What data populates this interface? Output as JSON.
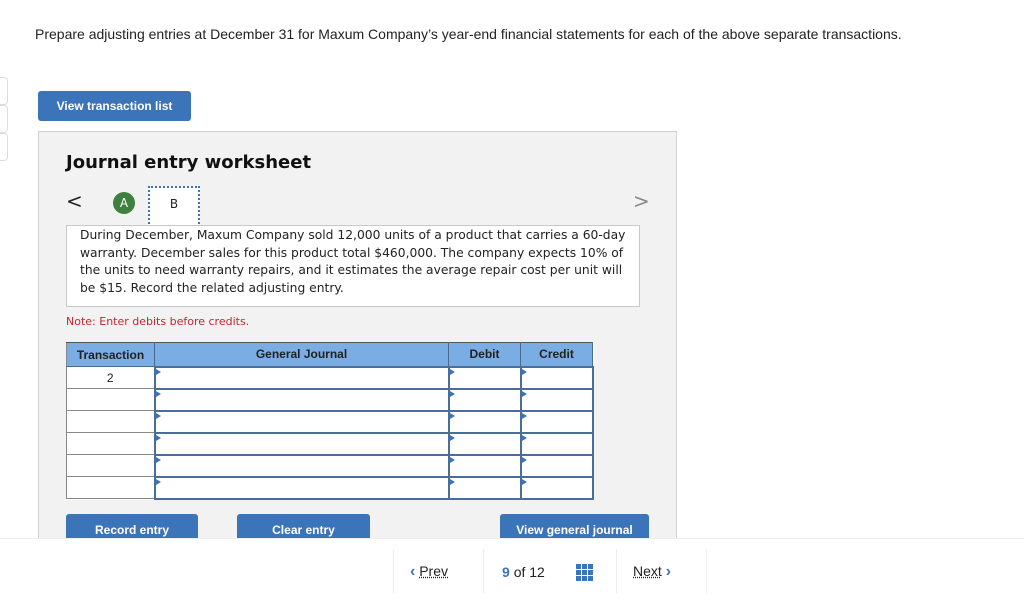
{
  "instructions": "Prepare adjusting entries at December 31 for Maxum Company’s year-end financial statements for each of the above separate transactions.",
  "buttons": {
    "view_transaction_list": "View transaction list",
    "record_entry": "Record entry",
    "clear_entry": "Clear entry",
    "view_general_journal": "View general journal"
  },
  "worksheet": {
    "title": "Journal entry worksheet",
    "prev_arrow": "<",
    "next_arrow": ">",
    "steps": [
      {
        "label": "A",
        "state": "completed"
      },
      {
        "label": "B",
        "state": "current"
      }
    ],
    "problem_text": "During December, Maxum Company sold 12,000 units of a product that carries a 60-day warranty. December sales for this product total $460,000. The company expects 10% of the units to need warranty repairs, and it estimates the average repair cost per unit will be $15. Record the related adjusting entry.",
    "note": "Note: Enter debits before credits."
  },
  "journal_table": {
    "headers": [
      "Transaction",
      "General Journal",
      "Debit",
      "Credit"
    ],
    "rows": [
      {
        "transaction": "2",
        "account": "",
        "debit": "",
        "credit": ""
      },
      {
        "transaction": "",
        "account": "",
        "debit": "",
        "credit": ""
      },
      {
        "transaction": "",
        "account": "",
        "debit": "",
        "credit": ""
      },
      {
        "transaction": "",
        "account": "",
        "debit": "",
        "credit": ""
      },
      {
        "transaction": "",
        "account": "",
        "debit": "",
        "credit": ""
      },
      {
        "transaction": "",
        "account": "",
        "debit": "",
        "credit": ""
      }
    ]
  },
  "pager": {
    "prev_label": "Prev",
    "next_label": "Next",
    "current": "9",
    "of_label": "of",
    "total": "12",
    "prev_icon": "‹",
    "next_icon": "›"
  },
  "colors": {
    "accent": "#3b74b8",
    "header_blue": "#7aade3",
    "step_completed": "#3f7f3f",
    "note_red": "#c0282d"
  }
}
